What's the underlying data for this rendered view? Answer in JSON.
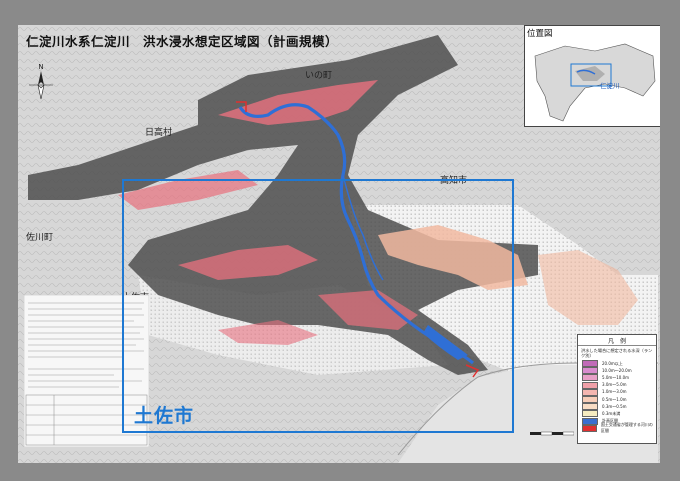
{
  "title": "仁淀川水系仁淀川　洪水浸水想定区域図（計画規模）",
  "place_labels": {
    "ino": "いの町",
    "hidaka": "日高村",
    "kochi": "高知市",
    "sakawa": "佐川町",
    "tosa_small": "土佐市"
  },
  "highlight_label": "土佐市",
  "inset": {
    "title": "位置図",
    "river_label": "仁淀川"
  },
  "legend": {
    "title": "凡　例",
    "subtitle": "洪水した場合に想定される水深（ランク別）",
    "items": [
      {
        "label": "20.0m以上",
        "color": "#c06bb8"
      },
      {
        "label": "10.0m〜20.0m",
        "color": "#d98ccf"
      },
      {
        "label": "5.0m〜10.0m",
        "color": "#e8a0c8"
      },
      {
        "label": "3.0m〜5.0m",
        "color": "#f0a0a8"
      },
      {
        "label": "1.0m〜3.0m",
        "color": "#f4b6b0"
      },
      {
        "label": "0.5m〜1.0m",
        "color": "#f7cdb8"
      },
      {
        "label": "0.3m〜0.5m",
        "color": "#f8dcc4"
      },
      {
        "label": "0.3m未満",
        "color": "#f6ecc0"
      },
      {
        "label": "計画区間",
        "color": "#3a6fd0"
      },
      {
        "label": "国土交通省が管理する河川の区間",
        "color": "#e03030"
      }
    ]
  },
  "colors": {
    "highlight": "#1e78d2",
    "river": "#2f6fd6",
    "flood_deep": "#e8707e",
    "flood_shallow": "#f1b9a0"
  }
}
